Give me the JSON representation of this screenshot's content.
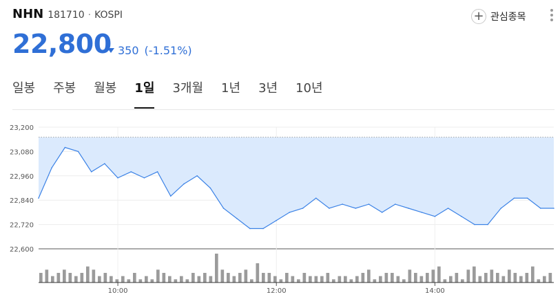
{
  "stock": {
    "name": "NHN",
    "code": "181710",
    "separator": "·",
    "market": "KOSPI",
    "price": "22,800",
    "change": "350",
    "change_pct": "(-1.51%)",
    "direction": "down"
  },
  "actions": {
    "favorite_label": "관심종목",
    "favorite_icon": "plus-icon",
    "more_icon": "more-vertical-icon"
  },
  "tabs": [
    {
      "label": "일봉"
    },
    {
      "label": "주봉"
    },
    {
      "label": "월봉"
    },
    {
      "label": "1일"
    },
    {
      "label": "3개월"
    },
    {
      "label": "1년"
    },
    {
      "label": "3년"
    },
    {
      "label": "10년"
    }
  ],
  "active_tab": 3,
  "colors": {
    "down_blue": "#2f6fd6",
    "line": "#3b82e6",
    "fill": "#dbeafd",
    "volume": "#9b9b9b"
  },
  "chart_data": {
    "type": "area",
    "y_ticks": [
      "23,200",
      "23,080",
      "22,960",
      "22,840",
      "22,720",
      "22,600"
    ],
    "ylim": [
      22600,
      23200
    ],
    "x_ticks": [
      "10:00",
      "12:00",
      "14:00"
    ],
    "x_range": [
      "09:00",
      "15:30"
    ],
    "previous_close": 23150,
    "series": [
      {
        "x": [
          "09:00",
          "09:10",
          "09:20",
          "09:30",
          "09:40",
          "09:50",
          "10:00",
          "10:10",
          "10:20",
          "10:30",
          "10:40",
          "10:50",
          "11:00",
          "11:10",
          "11:20",
          "11:30",
          "11:40",
          "11:50",
          "12:00",
          "12:10",
          "12:20",
          "12:30",
          "12:40",
          "12:50",
          "13:00",
          "13:10",
          "13:20",
          "13:30",
          "13:40",
          "13:50",
          "14:00",
          "14:10",
          "14:20",
          "14:30",
          "14:40",
          "14:50",
          "15:00",
          "15:10",
          "15:20",
          "15:30"
        ],
        "values": [
          22850,
          23000,
          23100,
          23080,
          22980,
          23020,
          22950,
          22980,
          22950,
          22980,
          22860,
          22920,
          22960,
          22900,
          22800,
          22750,
          22700,
          22700,
          22740,
          22780,
          22800,
          22850,
          22800,
          22820,
          22800,
          22820,
          22780,
          22820,
          22800,
          22780,
          22760,
          22800,
          22760,
          22720,
          22720,
          22800,
          22850,
          22850,
          22800,
          22800
        ]
      }
    ],
    "volume": [
      3,
      4,
      2,
      3,
      4,
      3,
      2,
      3,
      5,
      4,
      2,
      3,
      2,
      1,
      2,
      1,
      3,
      1,
      2,
      1,
      4,
      3,
      2,
      1,
      2,
      1,
      3,
      2,
      3,
      2,
      9,
      4,
      3,
      2,
      3,
      4,
      1,
      6,
      3,
      3,
      2,
      1,
      3,
      2,
      1,
      3,
      2,
      2,
      2,
      3,
      1,
      2,
      2,
      1,
      2,
      3,
      4,
      1,
      2,
      3,
      3,
      2,
      1,
      4,
      3,
      2,
      3,
      4,
      5,
      1,
      2,
      3,
      1,
      4,
      5,
      2,
      3,
      4,
      3,
      2,
      4,
      3,
      2,
      3,
      5,
      1,
      2,
      3
    ]
  }
}
